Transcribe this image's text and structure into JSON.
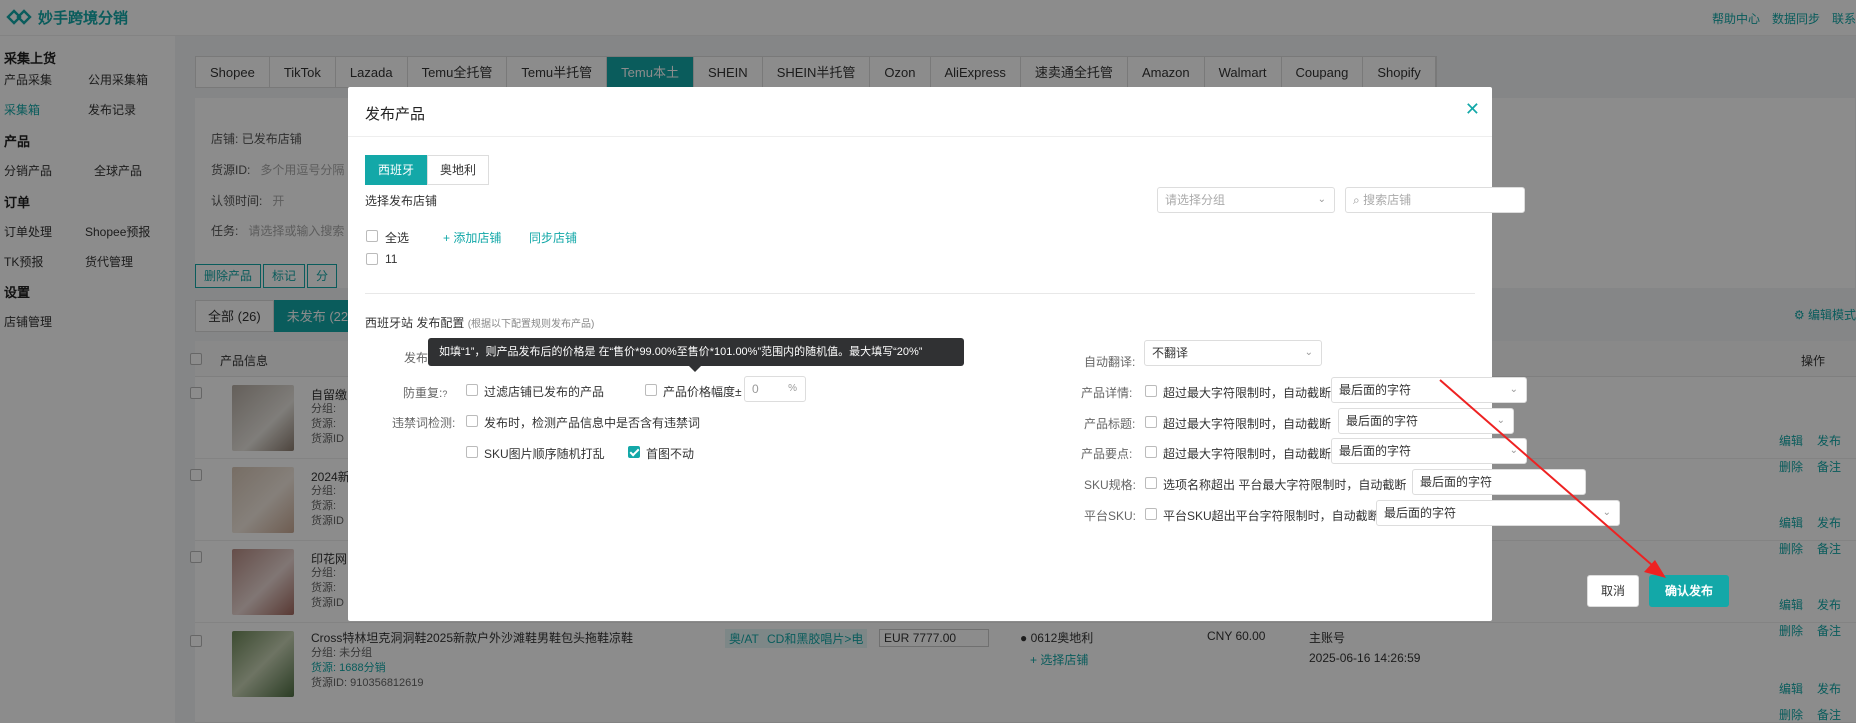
{
  "app": {
    "name": "妙手跨境分销",
    "top_links": [
      "帮助中心",
      "数据同步",
      "联系"
    ]
  },
  "sidebar": {
    "sections": [
      {
        "title": "采集上货",
        "items": [
          "产品采集",
          "公用采集箱",
          "采集箱",
          "发布记录"
        ]
      },
      {
        "title": "产品",
        "items": [
          "分销产品",
          "全球产品"
        ]
      },
      {
        "title": "订单",
        "items": [
          "订单处理",
          "Shopee预报",
          "TK预报",
          "货代管理"
        ]
      },
      {
        "title": "设置",
        "items": [
          "店铺管理"
        ]
      }
    ],
    "active_item": "采集箱"
  },
  "platform_tabs": [
    "Shopee",
    "TikTok",
    "Lazada",
    "Temu全托管",
    "Temu半托管",
    "Temu本土",
    "SHEIN",
    "SHEIN半托管",
    "Ozon",
    "AliExpress",
    "速卖通全托管",
    "Amazon",
    "Walmart",
    "Coupang",
    "Shopify"
  ],
  "active_platform": "Temu本土",
  "filters": {
    "shop_label": "店铺:",
    "shop_value": "已发布店铺",
    "source_label": "货源ID:",
    "source_placeholder": "多个用逗号分隔",
    "claim_label": "认领时间:",
    "claim_placeholder": "开",
    "task_label": "任务:",
    "task_placeholder": "请选择或输入搜索"
  },
  "action_buttons": [
    "删除产品",
    "标记",
    "分"
  ],
  "status_tabs": [
    "全部 (26)",
    "未发布 (22"
  ],
  "edit_mode": "编辑模式",
  "table": {
    "headers": {
      "product": "产品信息",
      "ops": "操作"
    },
    "rows": [
      {
        "title": "自留缴",
        "meta": [
          "分组:",
          "货源:",
          "货源ID"
        ],
        "ops": [
          "编辑",
          "发布",
          "删除",
          "备注"
        ]
      },
      {
        "title": "2024新",
        "meta": [
          "分组:",
          "货源:",
          "货源ID"
        ],
        "ops": [
          "编辑",
          "发布",
          "删除",
          "备注"
        ]
      },
      {
        "title": "印花网",
        "meta": [
          "分组:",
          "货源:",
          "货源ID"
        ],
        "ops": [
          "编辑",
          "发布",
          "删除",
          "备注"
        ]
      },
      {
        "title": "Cross特林坦克洞洞鞋2025新款户外沙滩鞋男鞋包头拖鞋凉鞋",
        "meta": [
          "分组: 未分组",
          "货源: 1688分销",
          "货源ID: 910356812619"
        ],
        "ops": [
          "编辑",
          "发布",
          "删除",
          "备注"
        ]
      }
    ],
    "row4_extra": {
      "region": "奥/AT",
      "category": "CD和黑胶唱片>电",
      "currency": "EUR",
      "price": "7777.00",
      "shop": "0612奥地利",
      "select_shop": "+ 选择店铺",
      "cost": "CNY 60.00",
      "account": "主账号",
      "time": "2025-06-16 14:26:59"
    }
  },
  "dialog": {
    "title": "发布产品",
    "region_tabs": [
      "西班牙",
      "奥地利"
    ],
    "active_region": "西班牙",
    "select_shop_label": "选择发布店铺",
    "group_placeholder": "请选择分组",
    "search_placeholder": "搜索店铺",
    "select_all": "全选",
    "add_shop": "+ 添加店铺",
    "sync_shop": "同步店铺",
    "shops": [
      "11"
    ],
    "config_title": "西班牙站 发布配置",
    "config_hint": "(根据以下配置规则发布产品)",
    "left": {
      "publish_label": "发布",
      "dedupe_label": "防重复:",
      "dedupe_filter": "过滤店铺已发布的产品",
      "price_range": "产品价格幅度±",
      "price_value": "0",
      "price_unit": "%",
      "banned_label": "违禁词检测:",
      "banned_text": "发布时，检测产品信息中是否含有违禁词",
      "sku_shuffle": "SKU图片顺序随机打乱",
      "first_image_fixed": "首图不动"
    },
    "right": {
      "auto_translate_label": "自动翻译:",
      "auto_translate_value": "不翻译",
      "detail_label": "产品详情:",
      "detail_text": "超过最大字符限制时，自动截断",
      "detail_value": "最后面的字符",
      "title_label": "产品标题:",
      "title_text": "超过最大字符限制时，自动截断",
      "title_value": "最后面的字符",
      "points_label": "产品要点:",
      "points_text": "超过最大字符限制时，自动截断",
      "points_value": "最后面的字符",
      "sku_label": "SKU规格:",
      "sku_text": "选项名称超出 平台最大字符限制时，自动截断",
      "sku_value": "最后面的字符",
      "platform_sku_label": "平台SKU:",
      "platform_sku_text": "平台SKU超出平台字符限制时，自动截断",
      "platform_sku_value": "最后面的字符"
    },
    "tooltip": "如填“1”，则产品发布后的价格是 在“售价*99.00%至售价*101.00%”范围内的随机值。最大填写“20%”",
    "cancel": "取消",
    "confirm": "确认发布"
  },
  "colors": {
    "accent": "#13a8a8",
    "annotation_arrow": "#ee2222"
  }
}
